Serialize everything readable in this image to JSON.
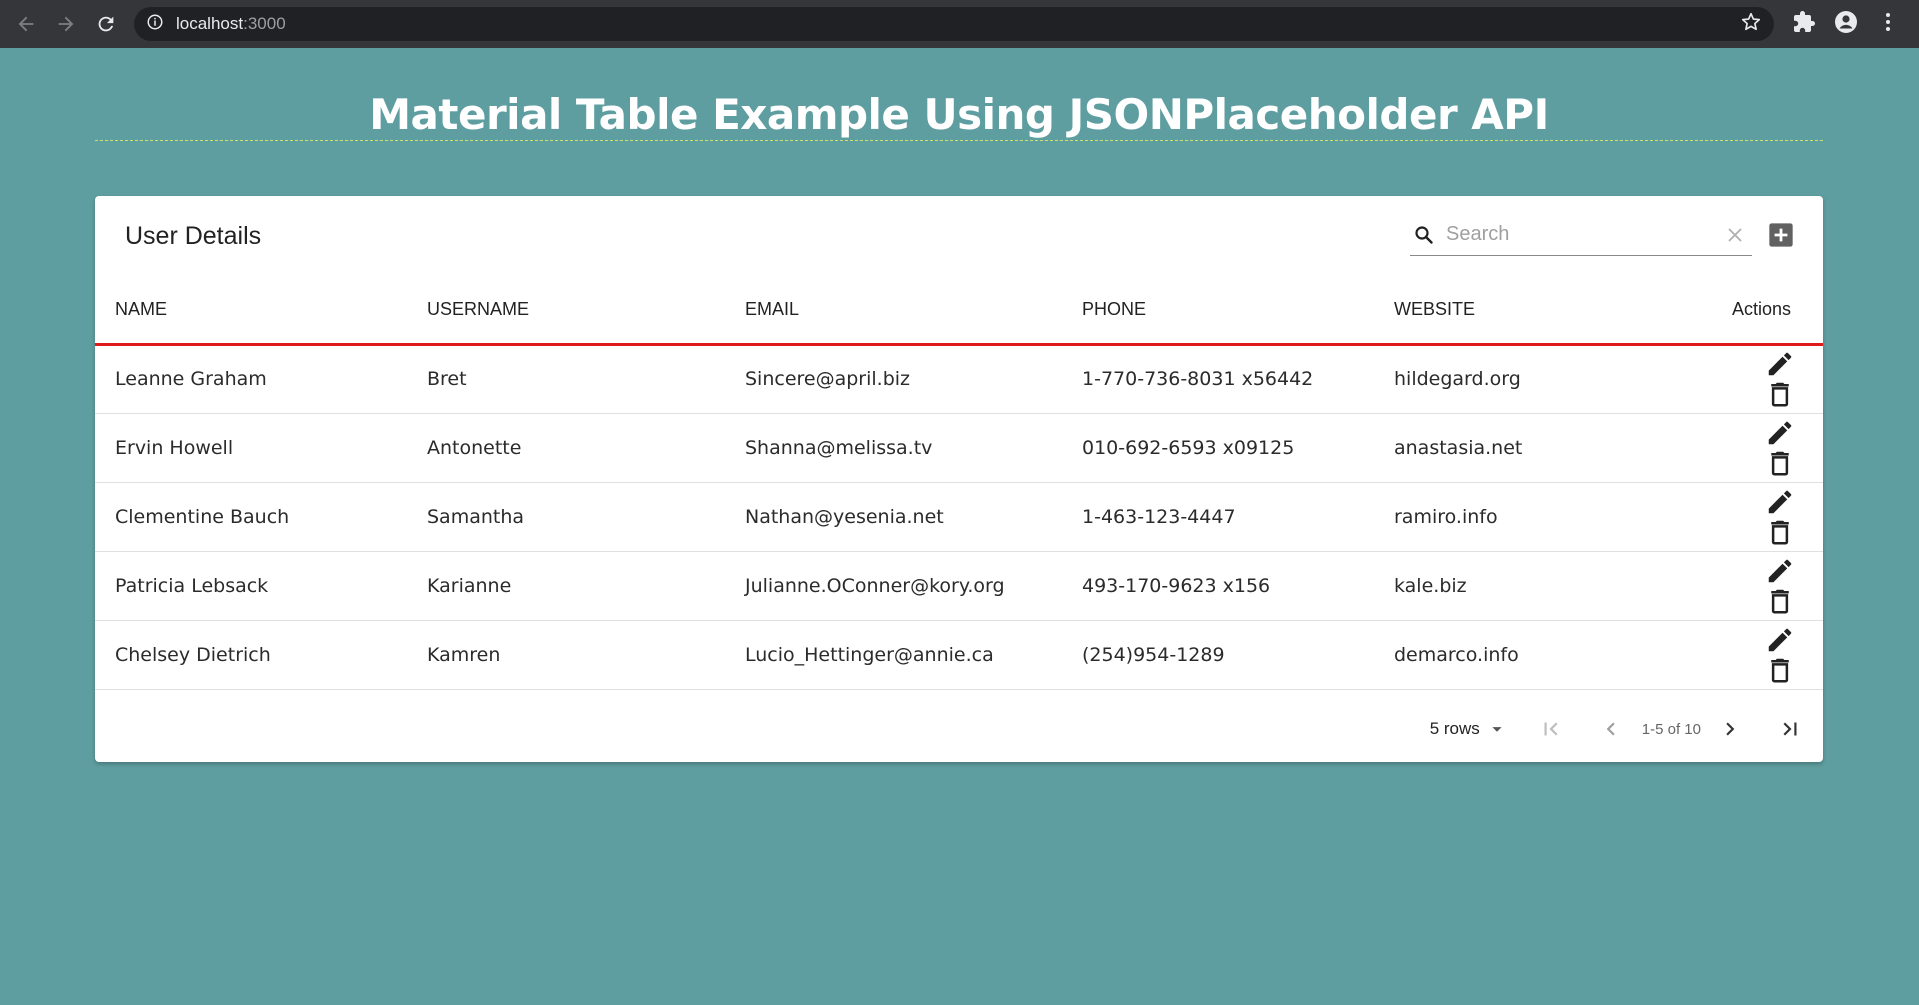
{
  "browser": {
    "url_host": "localhost",
    "url_port": ":3000"
  },
  "page": {
    "title": "Material Table Example Using JSONPlaceholder API"
  },
  "table": {
    "title": "User Details",
    "search_placeholder": "Search",
    "columns": [
      "NAME",
      "USERNAME",
      "EMAIL",
      "PHONE",
      "WEBSITE",
      "Actions"
    ],
    "rows": [
      {
        "name": "Leanne Graham",
        "username": "Bret",
        "email": "Sincere@april.biz",
        "phone": "1-770-736-8031 x56442",
        "website": "hildegard.org"
      },
      {
        "name": "Ervin Howell",
        "username": "Antonette",
        "email": "Shanna@melissa.tv",
        "phone": "010-692-6593 x09125",
        "website": "anastasia.net"
      },
      {
        "name": "Clementine Bauch",
        "username": "Samantha",
        "email": "Nathan@yesenia.net",
        "phone": "1-463-123-4447",
        "website": "ramiro.info"
      },
      {
        "name": "Patricia Lebsack",
        "username": "Karianne",
        "email": "Julianne.OConner@kory.org",
        "phone": "493-170-9623 x156",
        "website": "kale.biz"
      },
      {
        "name": "Chelsey Dietrich",
        "username": "Kamren",
        "email": "Lucio_Hettinger@annie.ca",
        "phone": "(254)954-1289",
        "website": "demarco.info"
      }
    ],
    "pagination": {
      "rows_label": "5 rows",
      "range_label": "1-5 of 10"
    }
  },
  "icons": {
    "back": "arrow-back-icon",
    "forward": "arrow-forward-icon",
    "reload": "reload-icon",
    "info": "info-icon",
    "bookmark": "star-icon",
    "extensions": "puzzle-icon",
    "profile": "account-icon",
    "menu": "more-vert-icon",
    "search": "search-icon",
    "clear": "close-icon",
    "add": "add-box-icon",
    "edit": "pencil-icon",
    "delete": "trash-icon"
  },
  "colors": {
    "page_bg": "#5f9ea0",
    "header_rule": "#e01a1a",
    "chrome_bg": "#35363a"
  }
}
